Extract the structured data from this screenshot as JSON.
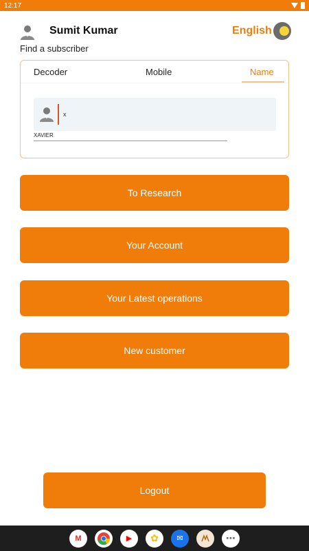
{
  "status_bar": {
    "time": "12:17"
  },
  "header": {
    "user_name": "Sumit Kumar",
    "language": "English"
  },
  "find_label": "Find a subscriber",
  "search": {
    "tabs": [
      {
        "label": "Decoder"
      },
      {
        "label": "Mobile"
      },
      {
        "label": "Name"
      }
    ],
    "active_tab": "Name",
    "input_value": "x",
    "result_text": "XAVIER"
  },
  "buttons": {
    "research": "To Research",
    "account": "Your Account",
    "latest": "Your Latest operations",
    "new_customer": "New customer",
    "logout": "Logout"
  },
  "taskbar": {
    "apps": [
      {
        "name": "gmail-icon",
        "glyph": "M",
        "color": "#d93025"
      },
      {
        "name": "chrome-icon",
        "glyph": "",
        "color": "#34a853"
      },
      {
        "name": "youtube-icon",
        "glyph": "▶",
        "color": "#ff0000"
      },
      {
        "name": "photos-icon",
        "glyph": "✿",
        "color": "#fbbc04"
      },
      {
        "name": "messages-icon",
        "glyph": "✉",
        "color": "#1a73e8"
      },
      {
        "name": "app-logo-icon",
        "glyph": "",
        "color": "#b06a18"
      },
      {
        "name": "app-drawer-icon",
        "glyph": "⋯",
        "color": "#5f6368"
      }
    ]
  },
  "colors": {
    "accent": "#f07c0a",
    "status_bar": "#f07c0a",
    "taskbar": "#1e1e1e"
  }
}
